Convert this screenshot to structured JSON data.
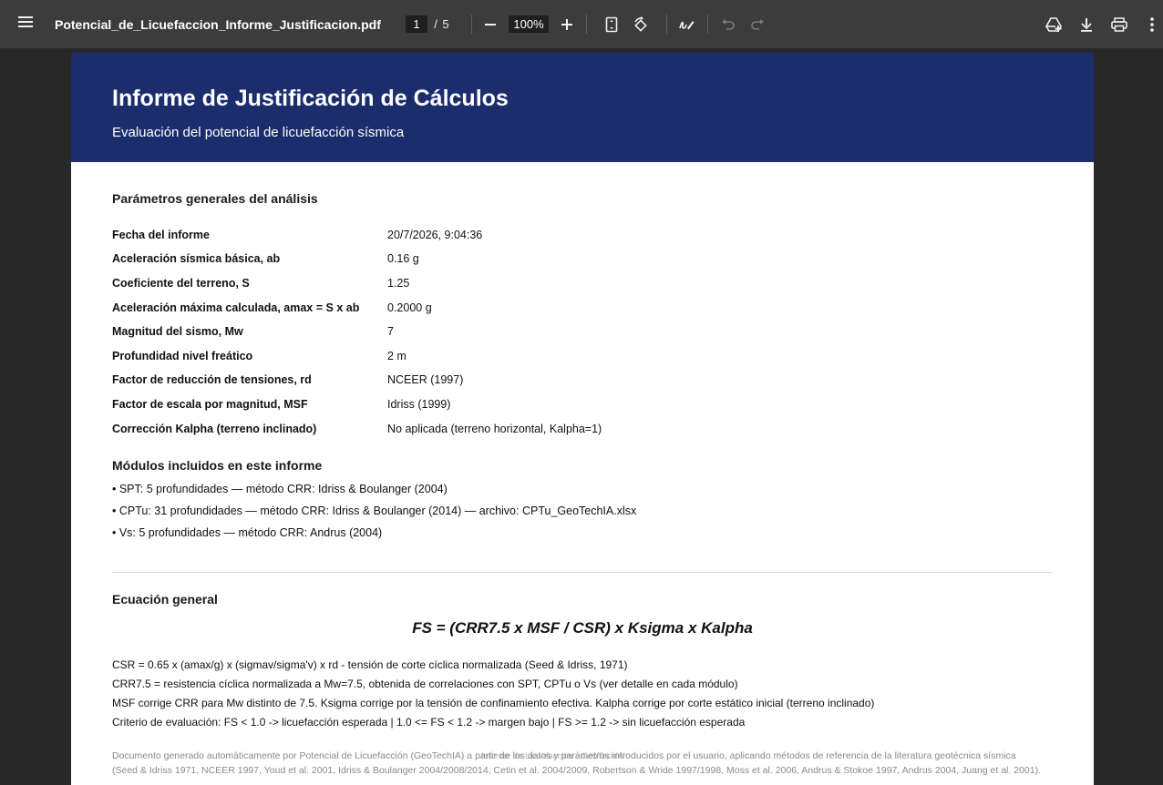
{
  "toolbar": {
    "menu_icon": "hamburger-menu-icon",
    "file_name": "Potencial_de_Licuefaccion_Informe_Justificacion.pdf",
    "current_page": "1",
    "page_separator": "/",
    "total_pages": "5",
    "zoom": "100%"
  },
  "document": {
    "title": "Informe de Justificación de Cálculos",
    "subtitle": "Evaluación del potencial de licuefacción sísmica",
    "params_heading": "Parámetros generales del análisis",
    "params": [
      {
        "label": "Fecha del informe",
        "value": "20/7/2026, 9:04:36"
      },
      {
        "label": "Aceleración sísmica básica, ab",
        "value": "0.16 g"
      },
      {
        "label": "Coeficiente del terreno, S",
        "value": "1.25"
      },
      {
        "label": "Aceleración máxima calculada, amax = S x ab",
        "value": "0.2000 g"
      },
      {
        "label": "Magnitud del sismo, Mw",
        "value": "7"
      },
      {
        "label": "Profundidad nivel freático",
        "value": "2 m"
      },
      {
        "label": "Factor de reducción de tensiones, rd",
        "value": "NCEER (1997)"
      },
      {
        "label": "Factor de escala por magnitud, MSF",
        "value": "Idriss (1999)"
      },
      {
        "label": "Corrección Kalpha (terreno inclinado)",
        "value": "No aplicada (terreno horizontal, Kalpha=1)"
      }
    ],
    "modules_heading": "Módulos incluidos en este informe",
    "modules": [
      "•  SPT: 5 profundidades — método CRR: Idriss & Boulanger (2004)",
      "•  CPTu: 31 profundidades — método CRR: Idriss & Boulanger (2014) — archivo: CPTu_GeoTechIA.xlsx",
      "•  Vs: 5 profundidades — método CRR: Andrus (2004)"
    ],
    "equation_heading": "Ecuación general",
    "equation": "FS = (CRR7.5 x MSF / CSR) x Ksigma x Kalpha",
    "equation_lines": [
      "CSR = 0.65 x (amax/g) x (sigmav/sigma'v) x rd   -   tensión de corte cíclica normalizada (Seed & Idriss, 1971)",
      "CRR7.5 = resistencia cíclica normalizada a Mw=7.5, obtenida de correlaciones con SPT, CPTu o Vs (ver detalle en cada módulo)",
      "MSF corrige CRR para Mw distinto de 7.5. Ksigma corrige por la tensión de confinamiento efectiva. Kalpha corrige por corte estático inicial (terreno inclinado)",
      "Criterio de evaluación:  FS < 1.0 -> licuefacción esperada   |   1.0 <= FS < 1.2 -> margen bajo   |   FS >= 1.2 -> sin licuefacción esperada"
    ],
    "footer_lines": [
      "Documento generado automáticamente por Potencial de Licuefacción (GeoTechIA) a partir de los datos y parámetros introducidos por el usuario, aplicando métodos de referencia de la literatura geotécnica sísmica",
      "(Seed & Idriss 1971, NCEER 1997, Youd et al. 2001, Idriss & Boulanger 2004/2008/2014, Cetin et al. 2004/2009, Robertson & Wride 1997/1998, Moss et al. 2006, Andrus & Stokoe 1997, Andrus 2004, Juang et al. 2001)."
    ],
    "watermark": "Informe de Licuefacción · GeoTechIA"
  },
  "colors": {
    "toolbar_bg": "#3c3c3c",
    "viewer_bg": "#282828",
    "banner_bg": "#1c2d6d",
    "page_bg": "#ffffff"
  }
}
